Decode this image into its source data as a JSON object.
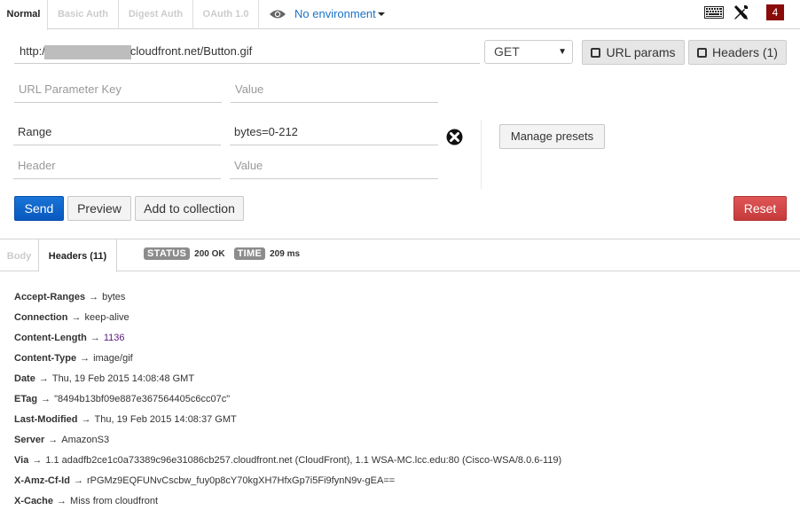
{
  "auth_tabs": [
    {
      "label": "Normal",
      "active": true
    },
    {
      "label": "Basic Auth",
      "active": false
    },
    {
      "label": "Digest Auth",
      "active": false
    },
    {
      "label": "OAuth 1.0",
      "active": false
    }
  ],
  "environment": {
    "label": "No environment",
    "icon": "eye-icon"
  },
  "top_icons": {
    "keyboard": "keyboard-icon",
    "settings": "wrench-screwdriver-icon",
    "notification_count": "4"
  },
  "request": {
    "url_prefix": "http:/",
    "url_suffix": "cloudfront.net/Button.gif",
    "method": "GET",
    "url_params_label": "URL params",
    "headers_label": "Headers (1)"
  },
  "url_params": {
    "key_placeholder": "URL Parameter Key",
    "value_placeholder": "Value"
  },
  "headers_editor": {
    "rows": [
      {
        "key": "Range",
        "value": "bytes=0-212"
      }
    ],
    "key_placeholder": "Header",
    "value_placeholder": "Value",
    "manage_presets_label": "Manage presets"
  },
  "actions": {
    "send": "Send",
    "preview": "Preview",
    "add_to_collection": "Add to collection",
    "reset": "Reset"
  },
  "response": {
    "tabs": [
      {
        "label": "Body",
        "active": false
      },
      {
        "label": "Headers (11)",
        "active": true
      }
    ],
    "status_label": "STATUS",
    "status_value": "200 OK",
    "time_label": "TIME",
    "time_value": "209 ms",
    "arrow": "→",
    "headers": [
      {
        "key": "Accept-Ranges",
        "value": "bytes"
      },
      {
        "key": "Connection",
        "value": "keep-alive"
      },
      {
        "key": "Content-Length",
        "value": "1136"
      },
      {
        "key": "Content-Type",
        "value": "image/gif"
      },
      {
        "key": "Date",
        "value": "Thu, 19 Feb 2015 14:08:48 GMT"
      },
      {
        "key": "ETag",
        "value": "\"8494b13bf09e887e367564405c6cc07c\""
      },
      {
        "key": "Last-Modified",
        "value": "Thu, 19 Feb 2015 14:08:37 GMT"
      },
      {
        "key": "Server",
        "value": "AmazonS3"
      },
      {
        "key": "Via",
        "value": "1.1 adadfb2ce1c0a73389c96e31086cb257.cloudfront.net (CloudFront), 1.1 WSA-MC.lcc.edu:80 (Cisco-WSA/8.0.6-119)"
      },
      {
        "key": "X-Amz-Cf-Id",
        "value": "rPGMz9EQFUNvCscbw_fuy0p8cY70kgXH7HfxGp7i5Fi9fynN9v-gEA=="
      },
      {
        "key": "X-Cache",
        "value": "Miss from cloudfront"
      }
    ]
  },
  "colors": {
    "send": "#0b5fc7",
    "reset": "#d04848",
    "env_link": "#1a73c7",
    "badge": "#8b0a0a"
  }
}
